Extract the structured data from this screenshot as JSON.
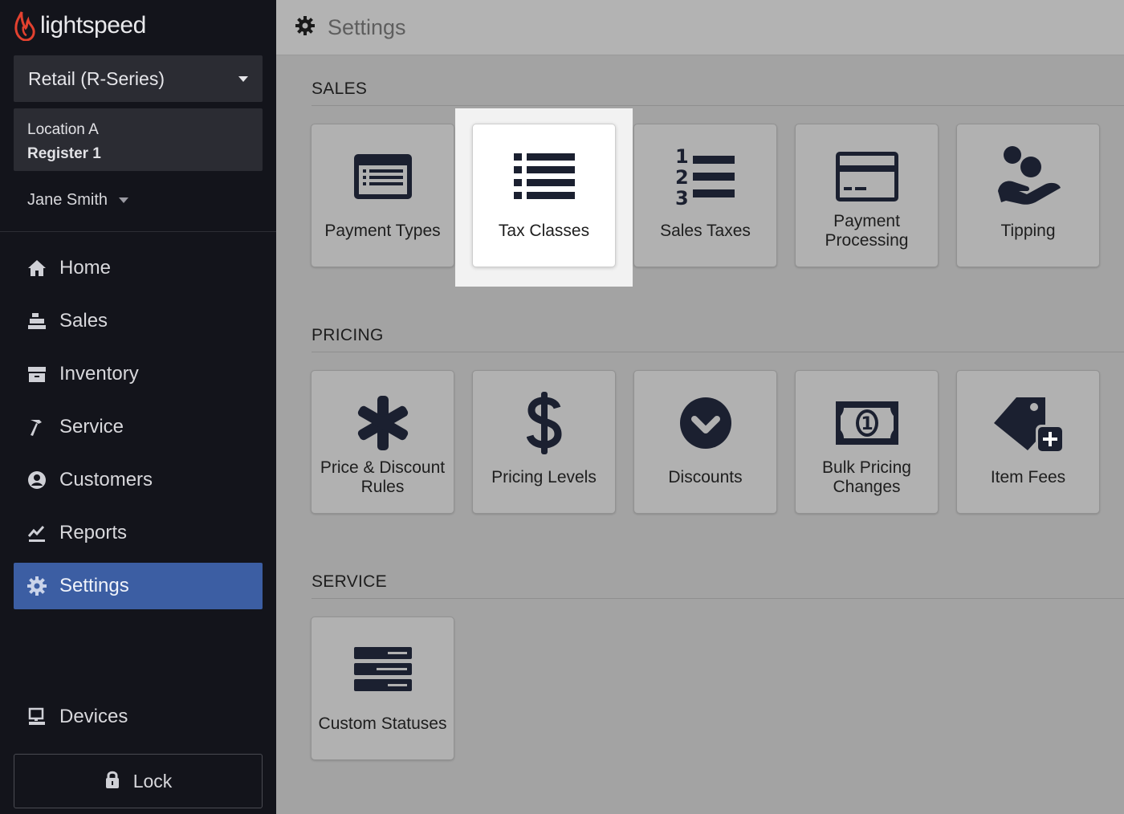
{
  "brand": {
    "name": "lightspeed",
    "accent": "#e3412f"
  },
  "product_selector": {
    "label": "Retail (R-Series)"
  },
  "location": {
    "name": "Location A",
    "register": "Register 1"
  },
  "user": {
    "name": "Jane Smith"
  },
  "nav": {
    "items": [
      {
        "label": "Home",
        "icon": "home-icon"
      },
      {
        "label": "Sales",
        "icon": "register-icon"
      },
      {
        "label": "Inventory",
        "icon": "inventory-icon"
      },
      {
        "label": "Service",
        "icon": "hammer-icon"
      },
      {
        "label": "Customers",
        "icon": "customer-icon"
      },
      {
        "label": "Reports",
        "icon": "chart-icon"
      },
      {
        "label": "Settings",
        "icon": "gear-icon",
        "active": true
      }
    ],
    "devices_label": "Devices",
    "lock_label": "Lock",
    "active_color": "#3c5ea3"
  },
  "header": {
    "title": "Settings"
  },
  "sections": {
    "sales": {
      "title": "SALES",
      "tiles": [
        {
          "label": "Payment Types",
          "icon": "card-list-icon"
        },
        {
          "label": "Tax Classes",
          "icon": "list-icon",
          "highlighted": true
        },
        {
          "label": "Sales Taxes",
          "icon": "numbered-list-icon"
        },
        {
          "label": "Payment Processing",
          "icon": "credit-card-icon"
        },
        {
          "label": "Tipping",
          "icon": "hand-coins-icon"
        }
      ]
    },
    "pricing": {
      "title": "PRICING",
      "tiles": [
        {
          "label": "Price & Discount Rules",
          "icon": "asterisk-icon"
        },
        {
          "label": "Pricing Levels",
          "icon": "dollar-icon"
        },
        {
          "label": "Discounts",
          "icon": "chevron-circle-icon"
        },
        {
          "label": "Bulk Pricing Changes",
          "icon": "banknote-icon"
        },
        {
          "label": "Item Fees",
          "icon": "tag-plus-icon"
        }
      ]
    },
    "service": {
      "title": "SERVICE",
      "tiles": [
        {
          "label": "Custom Statuses",
          "icon": "server-icon"
        }
      ]
    }
  }
}
